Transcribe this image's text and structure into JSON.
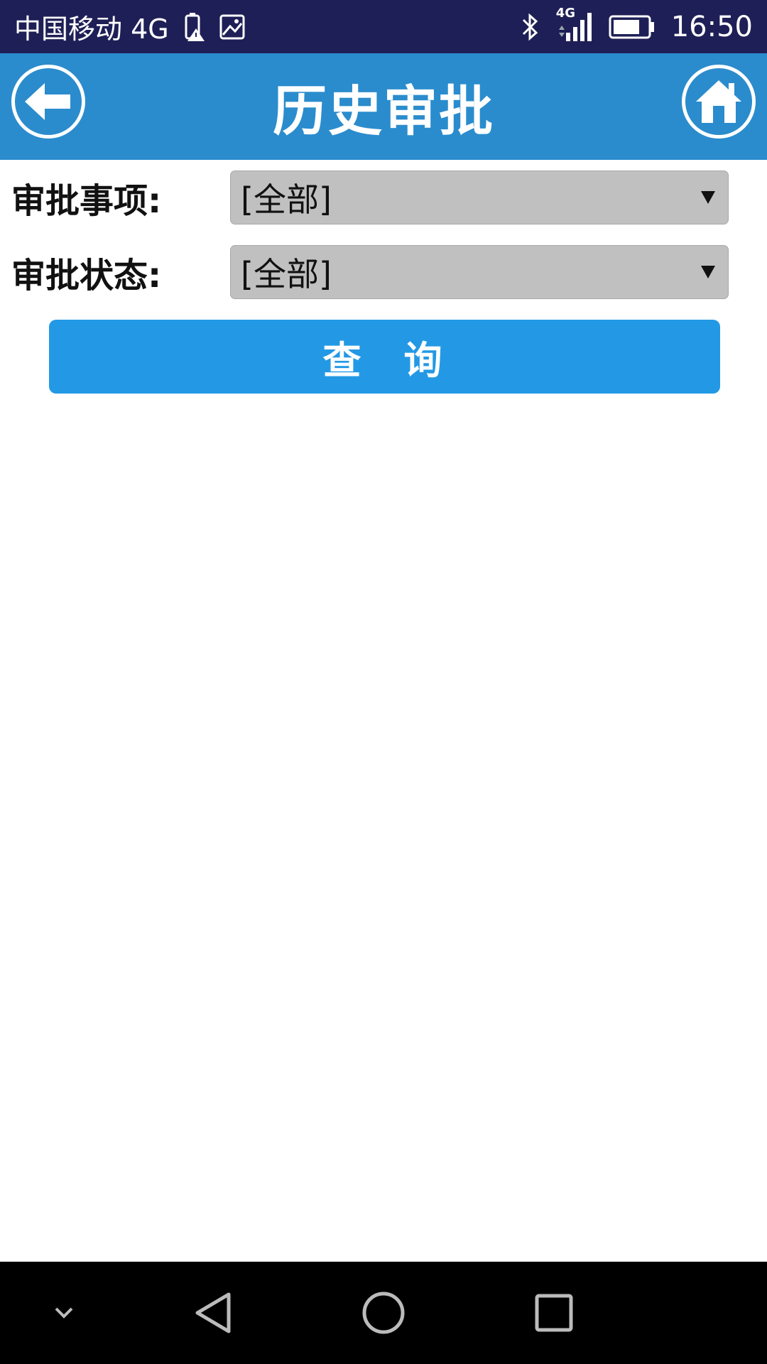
{
  "status_bar": {
    "carrier": "中国移动 4G",
    "network_badge": "4G",
    "time": "16:50",
    "icons": [
      "battery-alert-icon",
      "gallery-icon",
      "bluetooth-icon",
      "signal-icon",
      "battery-icon"
    ]
  },
  "header": {
    "title": "历史审批",
    "back_icon": "arrow-left-icon",
    "home_icon": "home-icon",
    "background": "#2a8ccd"
  },
  "form": {
    "item_label": "审批事项:",
    "item_value": "[全部]",
    "status_label": "审批状态:",
    "status_value": "[全部]"
  },
  "query_button": {
    "label": "查询",
    "color": "#2399e5"
  },
  "nav_bar": {
    "icons": [
      "collapse-chevron-icon",
      "back-triangle-icon",
      "home-circle-icon",
      "recents-square-icon"
    ]
  }
}
